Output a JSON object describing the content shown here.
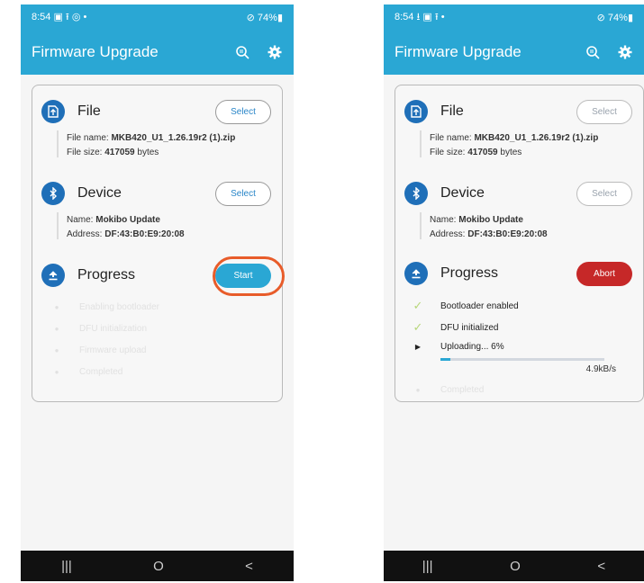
{
  "screens": [
    {
      "status_time": "8:54",
      "status_icons_left": "▣ ⭱ ◎ •",
      "status_right": "74%",
      "app_title": "Firmware Upgrade",
      "file": {
        "title": "File",
        "button": "Select",
        "name_label": "File name:",
        "name_value": "MKB420_U1_1.26.19r2 (1).zip",
        "size_label": "File size:",
        "size_value": "417059",
        "size_unit": "bytes"
      },
      "device": {
        "title": "Device",
        "button": "Select",
        "name_label": "Name:",
        "name_value": "Mokibo Update",
        "address_label": "Address:",
        "address_value": "DF:43:B0:E9:20:08"
      },
      "progress": {
        "title": "Progress",
        "button": "Start",
        "steps": [
          "Enabling bootloader",
          "DFU initialization",
          "Firmware upload",
          "Completed"
        ]
      }
    },
    {
      "status_time": "8:54",
      "status_icons_left": "⭳ ▣ ⭱ •",
      "status_right": "74%",
      "app_title": "Firmware Upgrade",
      "file": {
        "title": "File",
        "button": "Select",
        "name_label": "File name:",
        "name_value": "MKB420_U1_1.26.19r2 (1).zip",
        "size_label": "File size:",
        "size_value": "417059",
        "size_unit": "bytes"
      },
      "device": {
        "title": "Device",
        "button": "Select",
        "name_label": "Name:",
        "name_value": "Mokibo Update",
        "address_label": "Address:",
        "address_value": "DF:43:B0:E9:20:08"
      },
      "progress": {
        "title": "Progress",
        "button": "Abort",
        "steps": [
          "Bootloader enabled",
          "DFU initialized",
          "Uploading... 6%",
          "Completed"
        ],
        "upload_fraction": 0.06,
        "speed": "4.9kB/s"
      }
    }
  ],
  "nav": {
    "recents": "|||",
    "home": "O",
    "back": "<"
  },
  "colors": {
    "primary": "#2aa7d4",
    "icon_circle": "#1f6fb8",
    "abort": "#c62828",
    "highlight_ring": "#e85c2a",
    "check": "#b7d77a"
  }
}
